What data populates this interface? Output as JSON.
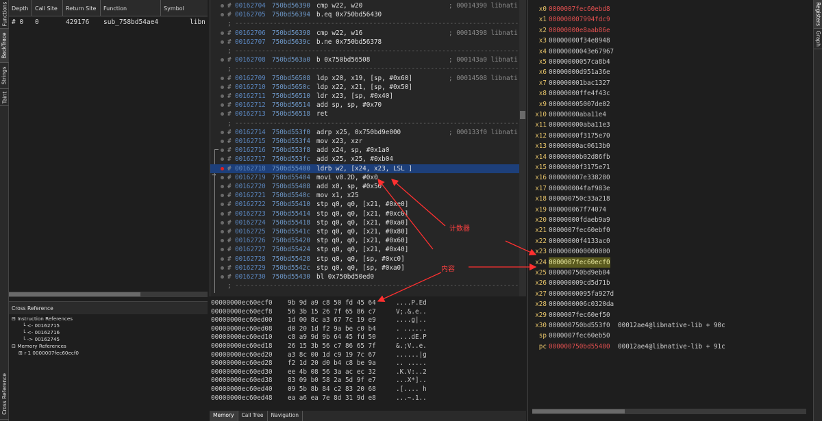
{
  "left_tabs": [
    "Functions",
    "BackTrace",
    "Strings",
    "Taint",
    "Cross Reference"
  ],
  "right_tabs": [
    "Registers",
    "Graph"
  ],
  "backtrace": {
    "headers": [
      "Depth",
      "Call Site",
      "Return Site",
      "Function",
      "Symbol"
    ],
    "row": {
      "depth": "# 0",
      "call_site": "0",
      "return_site": "429176",
      "function": "sub_758bd54ae4",
      "symbol": "libn"
    }
  },
  "xref": {
    "title": "Cross Reference",
    "instruction_refs_label": "Instruction References",
    "instruction_refs": [
      "<- 00162715",
      "<- 00162716",
      "-> 00162745"
    ],
    "memory_refs_label": "Memory References",
    "memory_ref": "r 1 0000007fec60ecf0"
  },
  "disasm": [
    {
      "cnt": "00162704",
      "addr": "750bd56390",
      "ins": "cmp w22, w20",
      "cmt": "; 00014390 libnati"
    },
    {
      "cnt": "00162705",
      "addr": "750bd56394",
      "ins": "b.eq 0x750bd56430",
      "cmt": ""
    },
    {
      "sep": true
    },
    {
      "cnt": "00162706",
      "addr": "750bd56398",
      "ins": "cmp w22, w16",
      "cmt": "; 00014398 libnati"
    },
    {
      "cnt": "00162707",
      "addr": "750bd5639c",
      "ins": "b.ne 0x750bd56378",
      "cmt": ""
    },
    {
      "sep": true
    },
    {
      "cnt": "00162708",
      "addr": "750bd563a0",
      "ins": "b 0x750bd56508",
      "cmt": "; 000143a0 libnati"
    },
    {
      "sep": true
    },
    {
      "cnt": "00162709",
      "addr": "750bd56508",
      "ins": "ldp x20, x19, [sp, #0x60]",
      "cmt": "; 00014508 libnati"
    },
    {
      "cnt": "00162710",
      "addr": "750bd5650c",
      "ins": "ldp x22, x21, [sp, #0x50]",
      "cmt": ""
    },
    {
      "cnt": "00162711",
      "addr": "750bd56510",
      "ins": "ldr x23, [sp, #0x40]",
      "cmt": ""
    },
    {
      "cnt": "00162712",
      "addr": "750bd56514",
      "ins": "add sp, sp, #0x70",
      "cmt": ""
    },
    {
      "cnt": "00162713",
      "addr": "750bd56518",
      "ins": "ret",
      "cmt": ""
    },
    {
      "sep": true
    },
    {
      "cnt": "00162714",
      "addr": "750bd553f0",
      "ins": "adrp x25, 0x750bd9e000",
      "cmt": "; 000133f0 libnati"
    },
    {
      "cnt": "00162715",
      "addr": "750bd553f4",
      "ins": "mov x23, xzr",
      "cmt": ""
    },
    {
      "cnt": "00162716",
      "addr": "750bd553f8",
      "ins": "add x24, sp, #0x1a0",
      "cmt": ""
    },
    {
      "cnt": "00162717",
      "addr": "750bd553fc",
      "ins": "add x25, x25, #0xb04",
      "cmt": ""
    },
    {
      "cnt": "00162718",
      "addr": "750bd55400",
      "ins": "ldrb w2, [x24, x23, LSL ]",
      "cmt": "",
      "sel": true
    },
    {
      "cnt": "00162719",
      "addr": "750bd55404",
      "ins": "movi v0.2D, #0x0",
      "cmt": ""
    },
    {
      "cnt": "00162720",
      "addr": "750bd55408",
      "ins": "add x0, sp, #0x50",
      "cmt": ""
    },
    {
      "cnt": "00162721",
      "addr": "750bd5540c",
      "ins": "mov x1, x25",
      "cmt": ""
    },
    {
      "cnt": "00162722",
      "addr": "750bd55410",
      "ins": "stp q0, q0, [x21, #0xe0]",
      "cmt": ""
    },
    {
      "cnt": "00162723",
      "addr": "750bd55414",
      "ins": "stp q0, q0, [x21, #0xc0]",
      "cmt": ""
    },
    {
      "cnt": "00162724",
      "addr": "750bd55418",
      "ins": "stp q0, q0, [x21, #0xa0]",
      "cmt": ""
    },
    {
      "cnt": "00162725",
      "addr": "750bd5541c",
      "ins": "stp q0, q0, [x21, #0x80]",
      "cmt": ""
    },
    {
      "cnt": "00162726",
      "addr": "750bd55420",
      "ins": "stp q0, q0, [x21, #0x60]",
      "cmt": ""
    },
    {
      "cnt": "00162727",
      "addr": "750bd55424",
      "ins": "stp q0, q0, [x21, #0x40]",
      "cmt": ""
    },
    {
      "cnt": "00162728",
      "addr": "750bd55428",
      "ins": "stp q0, q0, [sp, #0xc0]",
      "cmt": ""
    },
    {
      "cnt": "00162729",
      "addr": "750bd5542c",
      "ins": "stp q0, q0, [sp, #0xa0]",
      "cmt": ""
    },
    {
      "cnt": "00162730",
      "addr": "750bd55430",
      "ins": "bl 0x750bd50ed0",
      "cmt": ""
    },
    {
      "sep": true
    }
  ],
  "hex": [
    {
      "off": "00000000ec60ecf0",
      "bytes": "9b 9d a9 c8 50 fd 45 64",
      "ascii": "....P.Ed"
    },
    {
      "off": "00000000ec60ecf8",
      "bytes": "56 3b 15 26 7f 65 86 c7",
      "ascii": "V;.&.e.."
    },
    {
      "off": "00000000ec60ed00",
      "bytes": "1d 00 8c a3 67 7c 19 e9",
      "ascii": "....g|.."
    },
    {
      "off": "00000000ec60ed08",
      "bytes": "d0 20 1d f2 9a be c0 b4",
      "ascii": ". ......"
    },
    {
      "off": "00000000ec60ed10",
      "bytes": "c8 a9 9d 9b 64 45 fd 50",
      "ascii": "....dE.P"
    },
    {
      "off": "00000000ec60ed18",
      "bytes": "26 15 3b 56 c7 86 65 7f",
      "ascii": "&.;V..e."
    },
    {
      "off": "00000000ec60ed20",
      "bytes": "a3 8c 00 1d c9 19 7c 67",
      "ascii": "......|g"
    },
    {
      "off": "00000000ec60ed28",
      "bytes": "f2 1d 20 d0 b4 c8 be 9a",
      "ascii": ".. ....."
    },
    {
      "off": "00000000ec60ed30",
      "bytes": "ee 4b 08 56 3a ac ec 32",
      "ascii": ".K.V:..2"
    },
    {
      "off": "00000000ec60ed38",
      "bytes": "83 09 b0 58 2a 5d 9f e7",
      "ascii": "...X*].."
    },
    {
      "off": "00000000ec60ed40",
      "bytes": "09 5b 8b 84 c2 83 20 68",
      "ascii": ".[.... h"
    },
    {
      "off": "00000000ec60ed48",
      "bytes": "ea a6 ea 7e 8d 31 9d e8",
      "ascii": "...~.1.."
    }
  ],
  "bottom_tabs": [
    "Memory",
    "Call Tree",
    "Navigation"
  ],
  "registers": [
    {
      "name": "x0",
      "val": "0000007fec60ebd8",
      "chg": true
    },
    {
      "name": "x1",
      "val": "000000007994fdc9",
      "chg": true
    },
    {
      "name": "x2",
      "val": "00000000e8aab86e",
      "chg": true
    },
    {
      "name": "x3",
      "val": "00000000f34e8948"
    },
    {
      "name": "x4",
      "val": "00000000043e67967"
    },
    {
      "name": "x5",
      "val": "00000000057ca8b4"
    },
    {
      "name": "x6",
      "val": "00000000d951a36e"
    },
    {
      "name": "x7",
      "val": "000000001bac1327"
    },
    {
      "name": "x8",
      "val": "00000000ffe4f43c"
    },
    {
      "name": "x9",
      "val": "000000005007de02"
    },
    {
      "name": "x10",
      "val": "00000000aba11e4"
    },
    {
      "name": "x11",
      "val": "000000000aba11e3"
    },
    {
      "name": "x12",
      "val": "00000000f3175e70"
    },
    {
      "name": "x13",
      "val": "00000000ac0613b0"
    },
    {
      "name": "x14",
      "val": "00000000b02d86fb"
    },
    {
      "name": "x15",
      "val": "00000000f3175e71"
    },
    {
      "name": "x16",
      "val": "000000007e338280"
    },
    {
      "name": "x17",
      "val": "000000004faf983e"
    },
    {
      "name": "x18",
      "val": "000000750c33a218"
    },
    {
      "name": "x19",
      "val": "000000067f74074"
    },
    {
      "name": "x20",
      "val": "00000000fdaeb9a9"
    },
    {
      "name": "x21",
      "val": "0000007fec60ebf0"
    },
    {
      "name": "x22",
      "val": "00000000f4133ac0"
    },
    {
      "name": "x23",
      "val": "0000000000000000"
    },
    {
      "name": "x24",
      "val": "0000007fec60ecf0",
      "hl": true
    },
    {
      "name": "x25",
      "val": "000000750bd9eb04"
    },
    {
      "name": "x26",
      "val": "000000009cd5d71b"
    },
    {
      "name": "x27",
      "val": "00000000095fa927d"
    },
    {
      "name": "x28",
      "val": "0000000006c0320da"
    },
    {
      "name": "x29",
      "val": "0000007fec60ef50"
    },
    {
      "name": "x30",
      "val": "000000750bd553f0",
      "ann": "00012ae4@libnative-lib + 90c"
    },
    {
      "name": "sp",
      "val": "0000007fec60eb50"
    },
    {
      "name": "pc",
      "val": "000000750bd55400",
      "chg": true,
      "ann": "00012ae4@libnative-lib + 91c"
    }
  ],
  "annotations": {
    "counter": "计数器",
    "content": "内容"
  },
  "colors": {
    "annotation": "#ff3030",
    "selection": "#1d3f7a",
    "register_name": "#e8c56a",
    "changed": "#e35050"
  }
}
